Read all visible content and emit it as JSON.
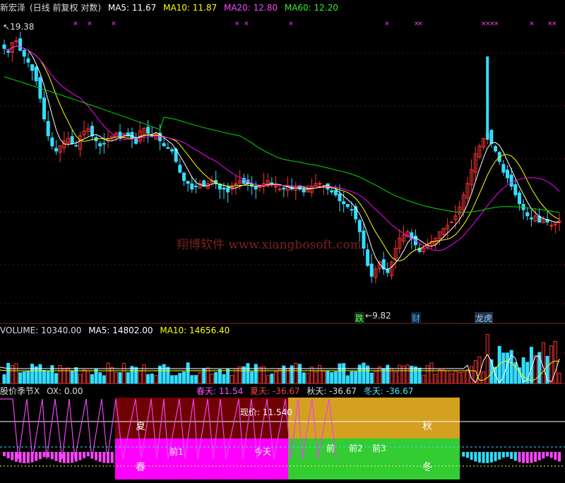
{
  "main": {
    "stock_name": "新宏泽",
    "period": "(日线 前复权 对数)",
    "ma5_label": "MA5: 11.67",
    "ma10_label": "MA10: 11.87",
    "ma20_label": "MA20: 12.80",
    "ma60_label": "MA60: 12.20",
    "high_marker": "19.38",
    "low_marker": "9.82",
    "watermark": "翔博软件 www.xiangbosoft.com",
    "event_tags": [
      {
        "label": "跌",
        "color": "#44dd44"
      },
      {
        "label": "财",
        "color": "#44aaff"
      },
      {
        "label": "龙虎",
        "color": "#88bbff"
      }
    ]
  },
  "volume": {
    "title_label": "VOLUME: 10340.00",
    "ma5_label": "MA5: 14802.00",
    "ma10_label": "MA10: 14656.40"
  },
  "season": {
    "title_label": "股价季节X",
    "ox_label": "OX: 0.00",
    "spring_label": "春天: 11.54",
    "summer_label": "夏天: -36.67",
    "autumn_label": "秋天: -36.67",
    "winter_label": "冬天: -36.67",
    "price_label": "现价: 11.540",
    "box_summer": "夏",
    "box_spring": "春",
    "box_autumn": "秋",
    "box_winter": "冬",
    "prev1": "前1",
    "today": "今天",
    "prev_a": "前",
    "prev_b": "前2",
    "prev_c": "前3"
  },
  "colors": {
    "up": "#ff3333",
    "down": "#33ddff",
    "ma5": "#ffffff",
    "ma10": "#ffff00",
    "ma20": "#ff00ff",
    "ma60": "#00dd00",
    "grid": "#882222",
    "summer_box": "#6e0000",
    "spring_box": "#ff00ff",
    "autumn_box": "#d4a020",
    "winter_box": "#33cc33"
  },
  "chart_data": {
    "type": "candlestick",
    "price_range": [
      9.82,
      19.38
    ],
    "closes": [
      18.6,
      18.4,
      18.9,
      19.0,
      18.5,
      18.2,
      17.9,
      17.5,
      17.0,
      16.2,
      15.3,
      14.6,
      14.2,
      14.0,
      14.2,
      14.4,
      14.5,
      14.3,
      14.2,
      14.6,
      14.8,
      14.9,
      14.6,
      14.4,
      14.2,
      14.3,
      14.5,
      14.6,
      14.7,
      14.5,
      14.7,
      14.6,
      14.5,
      14.3,
      14.8,
      14.9,
      14.7,
      14.6,
      14.7,
      14.4,
      14.2,
      14.1,
      14.0,
      13.6,
      13.2,
      12.9,
      12.8,
      12.6,
      12.7,
      12.8,
      12.7,
      12.8,
      12.9,
      12.8,
      12.6,
      12.6,
      12.5,
      12.7,
      12.8,
      12.9,
      12.8,
      12.8,
      12.7,
      12.6,
      12.7,
      12.8,
      12.9,
      12.8,
      12.7,
      12.6,
      12.6,
      12.7,
      12.6,
      12.7,
      12.6,
      12.5,
      12.6,
      12.7,
      12.8,
      12.8,
      12.7,
      12.6,
      12.5,
      12.4,
      12.2,
      12.1,
      12.0,
      11.9,
      11.6,
      11.2,
      10.7,
      10.2,
      9.9,
      10.1,
      10.3,
      10.1,
      10.0,
      10.3,
      10.7,
      11.0,
      11.1,
      11.2,
      11.0,
      10.8,
      10.6,
      10.7,
      10.8,
      10.9,
      11.0,
      11.2,
      11.3,
      11.4,
      11.5,
      11.7,
      12.0,
      12.4,
      12.8,
      13.3,
      13.9,
      14.2,
      14.5,
      14.7,
      14.3,
      14.0,
      13.6,
      13.2,
      13.0,
      12.7,
      12.4,
      12.1,
      11.9,
      11.7,
      11.6,
      11.7,
      11.5,
      11.6,
      11.5,
      11.4,
      11.5,
      11.54
    ],
    "volume_title": "VOLUME: 10340.00",
    "seasons": {
      "spring": 11.54,
      "summer": -36.67,
      "autumn": -36.67,
      "winter": -36.67,
      "price": 11.54
    }
  }
}
